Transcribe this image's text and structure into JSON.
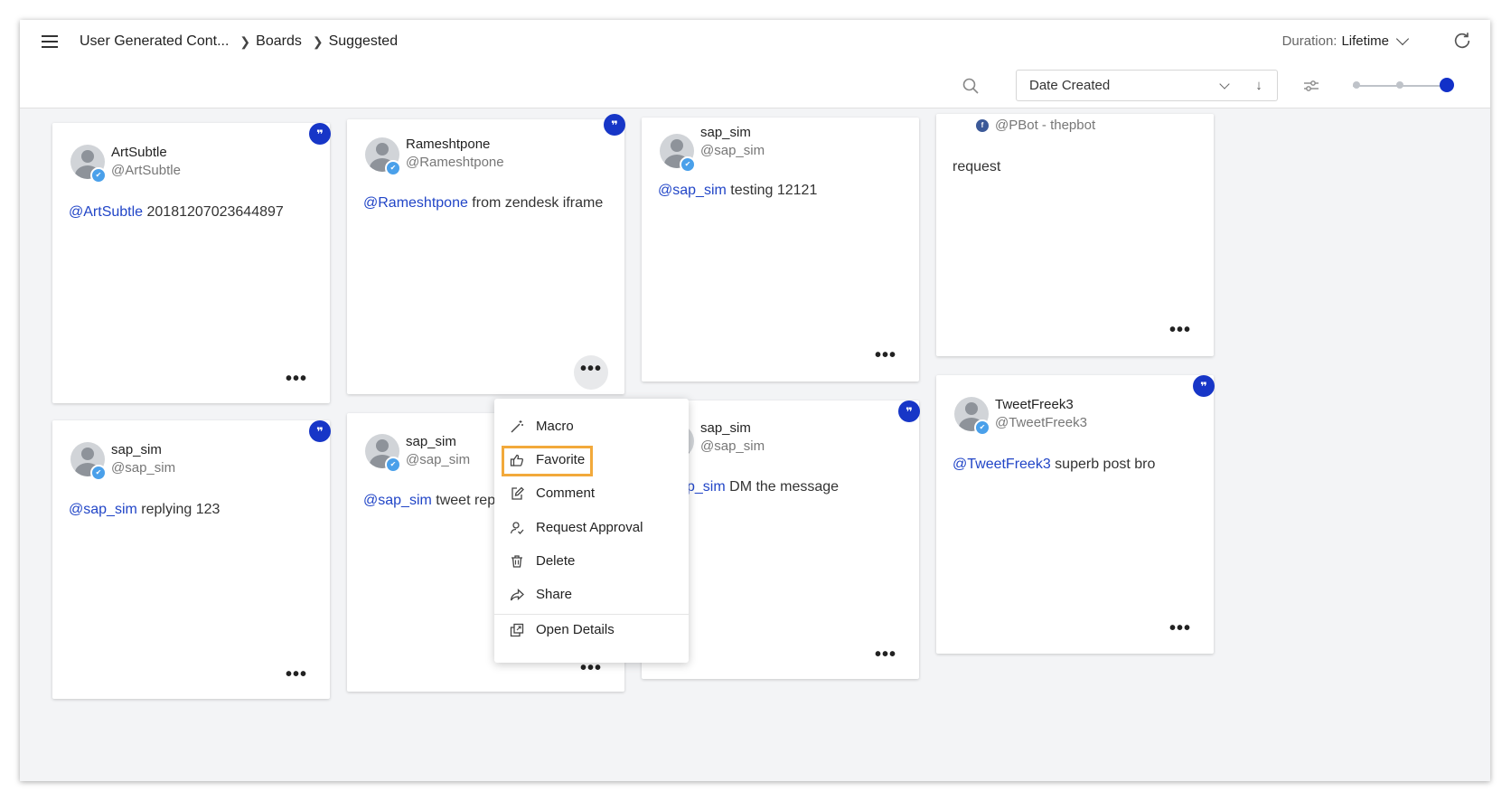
{
  "header": {
    "breadcrumb": [
      "User Generated Cont...",
      "Boards",
      "Suggested"
    ],
    "duration_label": "Duration:",
    "duration_value": "Lifetime"
  },
  "toolbar": {
    "sort_value": "Date Created",
    "sort_direction": "↓",
    "card_size_level": 3
  },
  "cards": [
    {
      "name": "ArtSubtle",
      "handle": "@ArtSubtle",
      "mention": "@ArtSubtle",
      "text": " 20181207023644897",
      "network": "twitter"
    },
    {
      "name": "Rameshtpone",
      "handle": "@Rameshtpone",
      "mention": "@Rameshtpone",
      "text": " from zendesk iframe",
      "network": "twitter"
    },
    {
      "name": "sap_sim",
      "handle": "@sap_sim",
      "mention": "@sap_sim",
      "text": " testing 12121",
      "network": "twitter"
    },
    {
      "name": "",
      "handle": "@PBot - thepbot",
      "mention": "",
      "text": "request",
      "network": "facebook"
    },
    {
      "name": "sap_sim",
      "handle": "@sap_sim",
      "mention": "@sap_sim",
      "text": " replying 123",
      "network": "twitter"
    },
    {
      "name": "sap_sim",
      "handle": "@sap_sim",
      "mention": "@sap_sim",
      "text": " tweet reply",
      "network": "twitter"
    },
    {
      "name": "sap_sim",
      "handle": "@sap_sim",
      "mention": "p_sim",
      "text": " DM the message",
      "network": "twitter"
    },
    {
      "name": "TweetFreek3",
      "handle": "@TweetFreek3",
      "mention": "@TweetFreek3",
      "text": " superb post bro",
      "network": "twitter"
    }
  ],
  "menu": {
    "items": [
      "Macro",
      "Favorite",
      "Comment",
      "Request Approval",
      "Delete",
      "Share",
      "Open Details"
    ],
    "highlighted": "Favorite"
  },
  "colors": {
    "accent": "#1736c7",
    "mention": "#2145c7",
    "highlight": "#f2a93b"
  }
}
